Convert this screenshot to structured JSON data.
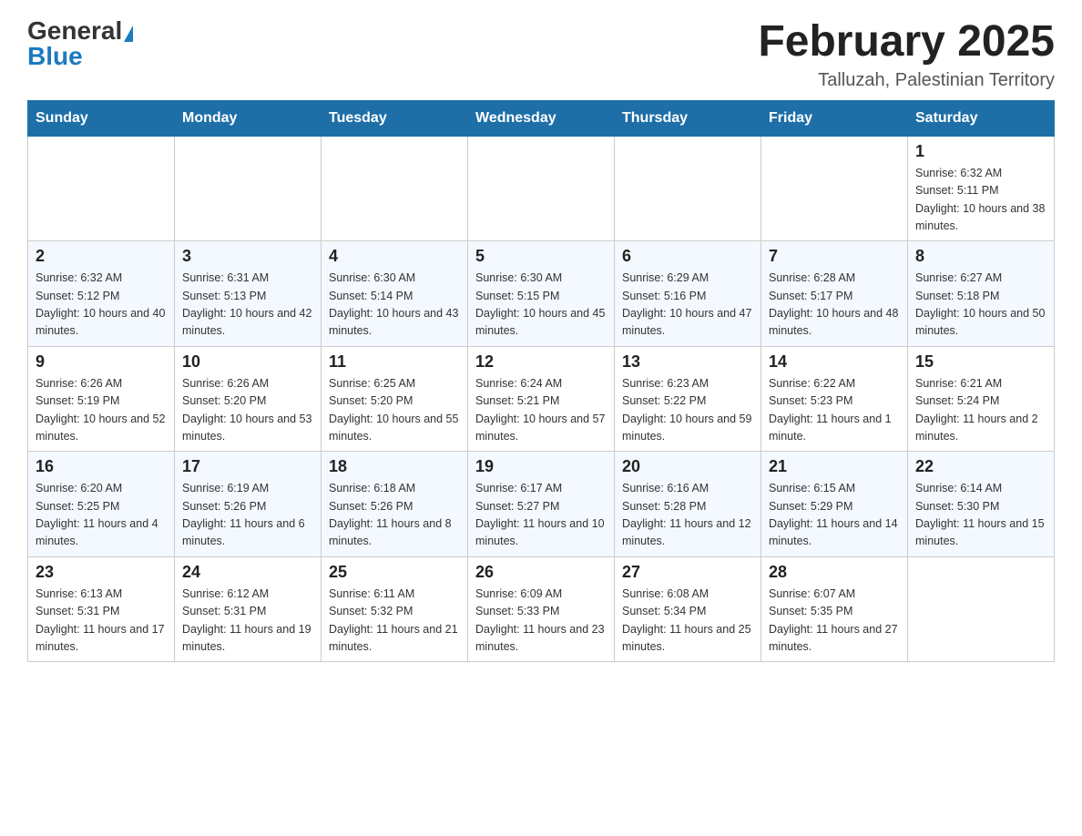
{
  "header": {
    "logo_general": "General",
    "logo_blue": "Blue",
    "month_title": "February 2025",
    "location": "Talluzah, Palestinian Territory"
  },
  "weekdays": [
    "Sunday",
    "Monday",
    "Tuesday",
    "Wednesday",
    "Thursday",
    "Friday",
    "Saturday"
  ],
  "weeks": [
    [
      {
        "day": "",
        "sunrise": "",
        "sunset": "",
        "daylight": ""
      },
      {
        "day": "",
        "sunrise": "",
        "sunset": "",
        "daylight": ""
      },
      {
        "day": "",
        "sunrise": "",
        "sunset": "",
        "daylight": ""
      },
      {
        "day": "",
        "sunrise": "",
        "sunset": "",
        "daylight": ""
      },
      {
        "day": "",
        "sunrise": "",
        "sunset": "",
        "daylight": ""
      },
      {
        "day": "",
        "sunrise": "",
        "sunset": "",
        "daylight": ""
      },
      {
        "day": "1",
        "sunrise": "Sunrise: 6:32 AM",
        "sunset": "Sunset: 5:11 PM",
        "daylight": "Daylight: 10 hours and 38 minutes."
      }
    ],
    [
      {
        "day": "2",
        "sunrise": "Sunrise: 6:32 AM",
        "sunset": "Sunset: 5:12 PM",
        "daylight": "Daylight: 10 hours and 40 minutes."
      },
      {
        "day": "3",
        "sunrise": "Sunrise: 6:31 AM",
        "sunset": "Sunset: 5:13 PM",
        "daylight": "Daylight: 10 hours and 42 minutes."
      },
      {
        "day": "4",
        "sunrise": "Sunrise: 6:30 AM",
        "sunset": "Sunset: 5:14 PM",
        "daylight": "Daylight: 10 hours and 43 minutes."
      },
      {
        "day": "5",
        "sunrise": "Sunrise: 6:30 AM",
        "sunset": "Sunset: 5:15 PM",
        "daylight": "Daylight: 10 hours and 45 minutes."
      },
      {
        "day": "6",
        "sunrise": "Sunrise: 6:29 AM",
        "sunset": "Sunset: 5:16 PM",
        "daylight": "Daylight: 10 hours and 47 minutes."
      },
      {
        "day": "7",
        "sunrise": "Sunrise: 6:28 AM",
        "sunset": "Sunset: 5:17 PM",
        "daylight": "Daylight: 10 hours and 48 minutes."
      },
      {
        "day": "8",
        "sunrise": "Sunrise: 6:27 AM",
        "sunset": "Sunset: 5:18 PM",
        "daylight": "Daylight: 10 hours and 50 minutes."
      }
    ],
    [
      {
        "day": "9",
        "sunrise": "Sunrise: 6:26 AM",
        "sunset": "Sunset: 5:19 PM",
        "daylight": "Daylight: 10 hours and 52 minutes."
      },
      {
        "day": "10",
        "sunrise": "Sunrise: 6:26 AM",
        "sunset": "Sunset: 5:20 PM",
        "daylight": "Daylight: 10 hours and 53 minutes."
      },
      {
        "day": "11",
        "sunrise": "Sunrise: 6:25 AM",
        "sunset": "Sunset: 5:20 PM",
        "daylight": "Daylight: 10 hours and 55 minutes."
      },
      {
        "day": "12",
        "sunrise": "Sunrise: 6:24 AM",
        "sunset": "Sunset: 5:21 PM",
        "daylight": "Daylight: 10 hours and 57 minutes."
      },
      {
        "day": "13",
        "sunrise": "Sunrise: 6:23 AM",
        "sunset": "Sunset: 5:22 PM",
        "daylight": "Daylight: 10 hours and 59 minutes."
      },
      {
        "day": "14",
        "sunrise": "Sunrise: 6:22 AM",
        "sunset": "Sunset: 5:23 PM",
        "daylight": "Daylight: 11 hours and 1 minute."
      },
      {
        "day": "15",
        "sunrise": "Sunrise: 6:21 AM",
        "sunset": "Sunset: 5:24 PM",
        "daylight": "Daylight: 11 hours and 2 minutes."
      }
    ],
    [
      {
        "day": "16",
        "sunrise": "Sunrise: 6:20 AM",
        "sunset": "Sunset: 5:25 PM",
        "daylight": "Daylight: 11 hours and 4 minutes."
      },
      {
        "day": "17",
        "sunrise": "Sunrise: 6:19 AM",
        "sunset": "Sunset: 5:26 PM",
        "daylight": "Daylight: 11 hours and 6 minutes."
      },
      {
        "day": "18",
        "sunrise": "Sunrise: 6:18 AM",
        "sunset": "Sunset: 5:26 PM",
        "daylight": "Daylight: 11 hours and 8 minutes."
      },
      {
        "day": "19",
        "sunrise": "Sunrise: 6:17 AM",
        "sunset": "Sunset: 5:27 PM",
        "daylight": "Daylight: 11 hours and 10 minutes."
      },
      {
        "day": "20",
        "sunrise": "Sunrise: 6:16 AM",
        "sunset": "Sunset: 5:28 PM",
        "daylight": "Daylight: 11 hours and 12 minutes."
      },
      {
        "day": "21",
        "sunrise": "Sunrise: 6:15 AM",
        "sunset": "Sunset: 5:29 PM",
        "daylight": "Daylight: 11 hours and 14 minutes."
      },
      {
        "day": "22",
        "sunrise": "Sunrise: 6:14 AM",
        "sunset": "Sunset: 5:30 PM",
        "daylight": "Daylight: 11 hours and 15 minutes."
      }
    ],
    [
      {
        "day": "23",
        "sunrise": "Sunrise: 6:13 AM",
        "sunset": "Sunset: 5:31 PM",
        "daylight": "Daylight: 11 hours and 17 minutes."
      },
      {
        "day": "24",
        "sunrise": "Sunrise: 6:12 AM",
        "sunset": "Sunset: 5:31 PM",
        "daylight": "Daylight: 11 hours and 19 minutes."
      },
      {
        "day": "25",
        "sunrise": "Sunrise: 6:11 AM",
        "sunset": "Sunset: 5:32 PM",
        "daylight": "Daylight: 11 hours and 21 minutes."
      },
      {
        "day": "26",
        "sunrise": "Sunrise: 6:09 AM",
        "sunset": "Sunset: 5:33 PM",
        "daylight": "Daylight: 11 hours and 23 minutes."
      },
      {
        "day": "27",
        "sunrise": "Sunrise: 6:08 AM",
        "sunset": "Sunset: 5:34 PM",
        "daylight": "Daylight: 11 hours and 25 minutes."
      },
      {
        "day": "28",
        "sunrise": "Sunrise: 6:07 AM",
        "sunset": "Sunset: 5:35 PM",
        "daylight": "Daylight: 11 hours and 27 minutes."
      },
      {
        "day": "",
        "sunrise": "",
        "sunset": "",
        "daylight": ""
      }
    ]
  ]
}
